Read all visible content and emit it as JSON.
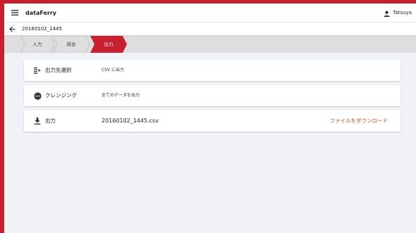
{
  "app": {
    "title": "dataFerry",
    "user_name": "Tatsuya"
  },
  "project": {
    "name": "20160102_1445"
  },
  "steps": [
    {
      "label": "入力",
      "active": false
    },
    {
      "label": "結合",
      "active": false
    },
    {
      "label": "出力",
      "active": true
    }
  ],
  "cards": [
    {
      "label": "出力先選択",
      "value": "CSV に出力",
      "icon": "output-destination-icon"
    },
    {
      "label": "クレンジング",
      "value": "全てのデータを出力",
      "icon": "cleansing-icon"
    },
    {
      "label": "出力",
      "value": "20160102_1445.csv",
      "icon": "download-icon",
      "action": "ファイルをダウンロード"
    }
  ],
  "colors": {
    "accent": "#c8202e",
    "link": "#d0482a",
    "background": "#f1f2f7"
  }
}
